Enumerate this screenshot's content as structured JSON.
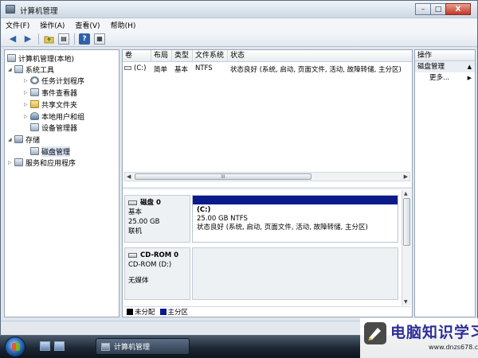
{
  "window": {
    "title": "计算机管理",
    "controls": [
      "–",
      "□",
      "X"
    ]
  },
  "menu": [
    "文件(F)",
    "操作(A)",
    "查看(V)",
    "帮助(H)"
  ],
  "toolbar": {
    "icons": [
      "back-arrow-icon",
      "forward-arrow-icon",
      "up-folder-icon",
      "show-tree-icon",
      "help-icon",
      "properties-icon"
    ],
    "help_label": "?"
  },
  "tree": {
    "root": "计算机管理(本地)",
    "system_tools": "系统工具",
    "task_scheduler": "任务计划程序",
    "event_viewer": "事件查看器",
    "shared_folders": "共享文件夹",
    "local_users": "本地用户和组",
    "device_manager": "设备管理器",
    "storage": "存储",
    "disk_management": "磁盘管理",
    "services_apps": "服务和应用程序"
  },
  "volume_list": {
    "columns": [
      "卷",
      "布局",
      "类型",
      "文件系统",
      "状态"
    ],
    "rows": [
      {
        "volume": "(C:)",
        "layout": "简单",
        "type": "基本",
        "fs": "NTFS",
        "status": "状态良好 (系统, 启动, 页面文件, 活动, 故障转储, 主分区)"
      }
    ],
    "scroll_grip": "III"
  },
  "disks": {
    "disk0": {
      "name": "磁盘 0",
      "type": "基本",
      "size": "25.00 GB",
      "status": "联机",
      "partition": {
        "label": "(C:)",
        "size_fs": "25.00 GB NTFS",
        "status": "状态良好 (系统, 启动, 页面文件, 活动, 故障转储, 主分区)"
      }
    },
    "cdrom0": {
      "name": "CD-ROM 0",
      "drive": "CD-ROM (D:)",
      "media": "无媒体"
    }
  },
  "legend": [
    {
      "label": "未分配",
      "color": "#000000"
    },
    {
      "label": "主分区",
      "color": "#0b1a8a"
    }
  ],
  "actions": {
    "header": "操作",
    "section": "磁盘管理",
    "more": "更多..."
  },
  "taskbar": {
    "task_label": "计算机管理"
  },
  "watermark": {
    "text": "电脑知识学习网",
    "url": "www.dnzs678.com"
  },
  "colors": {
    "primary_partition": "#0b1a8a",
    "accent": "#2e62a8"
  }
}
